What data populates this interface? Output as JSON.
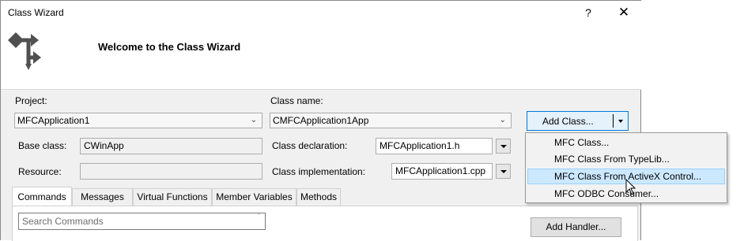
{
  "window": {
    "title": "Class Wizard",
    "help_glyph": "?",
    "close_glyph": "✕"
  },
  "header": {
    "title": "Welcome to the Class Wizard",
    "icon": "class-wizard-icon"
  },
  "project": {
    "label": "Project:",
    "value": "MFCApplication1"
  },
  "class_name": {
    "label": "Class name:",
    "value": "CMFCApplication1App"
  },
  "add_class": {
    "label": "Add Class..."
  },
  "base_class": {
    "label": "Base class:",
    "value": "CWinApp"
  },
  "resource": {
    "label": "Resource:",
    "value": ""
  },
  "class_declaration": {
    "label": "Class declaration:",
    "value": "MFCApplication1.h"
  },
  "class_implementation": {
    "label": "Class implementation:",
    "value": "MFCApplication1.cpp"
  },
  "tabs": [
    {
      "label": "Commands",
      "active": true
    },
    {
      "label": "Messages",
      "active": false
    },
    {
      "label": "Virtual Functions",
      "active": false
    },
    {
      "label": "Member Variables",
      "active": false
    },
    {
      "label": "Methods",
      "active": false
    }
  ],
  "search": {
    "placeholder": "Search Commands"
  },
  "add_handler": {
    "label": "Add Handler..."
  },
  "add_class_menu": {
    "items": [
      {
        "label": "MFC Class..."
      },
      {
        "label": "MFC Class From TypeLib..."
      },
      {
        "label": "MFC Class From ActiveX Control...",
        "highlighted": true
      },
      {
        "label": "MFC ODBC Consumer..."
      }
    ]
  },
  "colors": {
    "accent": "#0078d7",
    "highlight": "#cce8ff",
    "dialog_bg": "#f0f0f0"
  }
}
